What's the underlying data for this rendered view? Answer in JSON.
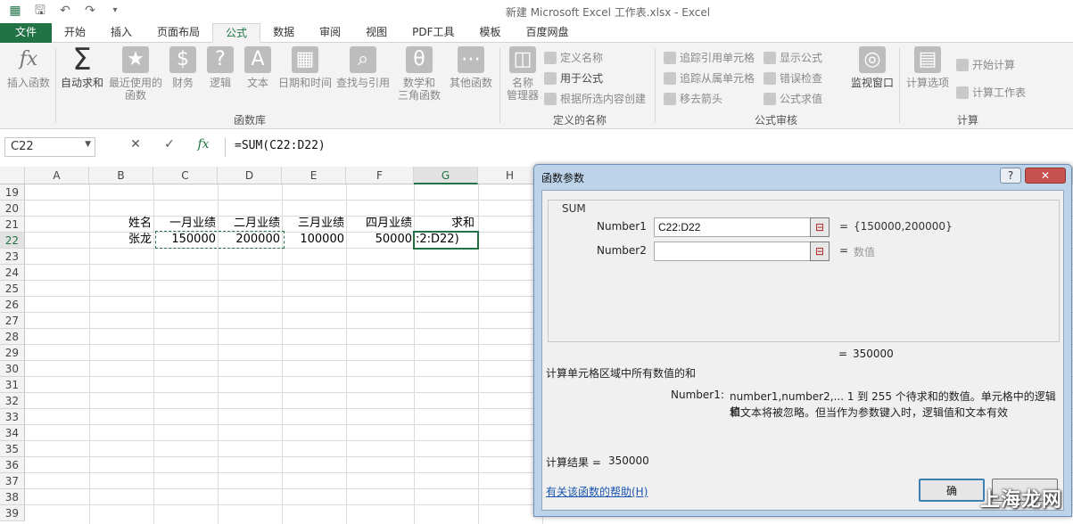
{
  "title_bar": {
    "window_title": "新建 Microsoft Excel 工作表.xlsx - Excel",
    "save_icon": "save-icon",
    "undo_icon": "undo-icon",
    "redo_icon": "redo-icon"
  },
  "tabs": [
    "文件",
    "开始",
    "插入",
    "页面布局",
    "公式",
    "数据",
    "审阅",
    "视图",
    "PDF工具",
    "模板",
    "百度网盘"
  ],
  "active_tab": "公式",
  "ribbon": {
    "function_library": {
      "label": "函数库",
      "insert_function": "插入函数",
      "autosum": "自动求和",
      "recent_1": "最近使用的",
      "recent_2": "函数",
      "financial": "财务",
      "logical": "逻辑",
      "text": "文本",
      "datetime": "日期和时间",
      "lookup": "查找与引用",
      "math_1": "数学和",
      "math_2": "三角函数",
      "more": "其他函数"
    },
    "defined_names": {
      "label": "定义的名称",
      "name_manager_1": "名称",
      "name_manager_2": "管理器",
      "define_name": "定义名称",
      "use_in_formula": "用于公式",
      "create_from_selection": "根据所选内容创建"
    },
    "formula_auditing": {
      "label": "公式审核",
      "trace_precedents": "追踪引用单元格",
      "trace_dependents": "追踪从属单元格",
      "remove_arrows": "移去箭头",
      "show_formulas": "显示公式",
      "error_checking": "错误检查",
      "evaluate_formula": "公式求值",
      "watch_window": "监视窗口"
    },
    "calculation": {
      "label": "计算",
      "calc_options": "计算选项",
      "calc_now": "开始计算",
      "calc_sheet": "计算工作表"
    }
  },
  "formula_bar": {
    "name_box": "C22",
    "cancel": "✕",
    "enter": "✓",
    "fx": "fx",
    "formula": "=SUM(C22:D22)"
  },
  "sheet": {
    "columns": [
      "A",
      "B",
      "C",
      "D",
      "E",
      "F",
      "G",
      "H"
    ],
    "rows": [
      "19",
      "20",
      "21",
      "22",
      "23",
      "24",
      "25",
      "26",
      "27",
      "28",
      "29",
      "30",
      "31",
      "32",
      "33",
      "34",
      "35",
      "36",
      "37",
      "38",
      "39"
    ],
    "header_row": [
      "姓名",
      "一月业绩",
      "二月业绩",
      "三月业绩",
      "四月业绩",
      "求和"
    ],
    "data_row": [
      "张龙",
      "150000",
      "200000",
      "100000",
      "50000",
      ":2:D22)"
    ]
  },
  "dialog": {
    "title": "函数参数",
    "help_button": "?",
    "close_button": "✕",
    "function_name": "SUM",
    "arg1_label": "Number1",
    "arg1_value": "C22:D22",
    "arg1_result": "{150000,200000}",
    "arg2_label": "Number2",
    "arg2_value": "",
    "arg2_result": "数值",
    "equals": "=",
    "formula_result_value": "350000",
    "description": "计算单元格区域中所有数值的和",
    "arg_help_label": "Number1:",
    "arg_help_line1": "number1,number2,...  1 到 255 个待求和的数值。单元格中的逻辑值",
    "arg_help_line2": "和文本将被忽略。但当作为参数键入时，逻辑值和文本有效",
    "calc_result_label": "计算结果 =",
    "calc_result_value": "350000",
    "help_link": "有关该函数的帮助(H)",
    "ok_button": "确",
    "watermark": "上海龙网"
  }
}
